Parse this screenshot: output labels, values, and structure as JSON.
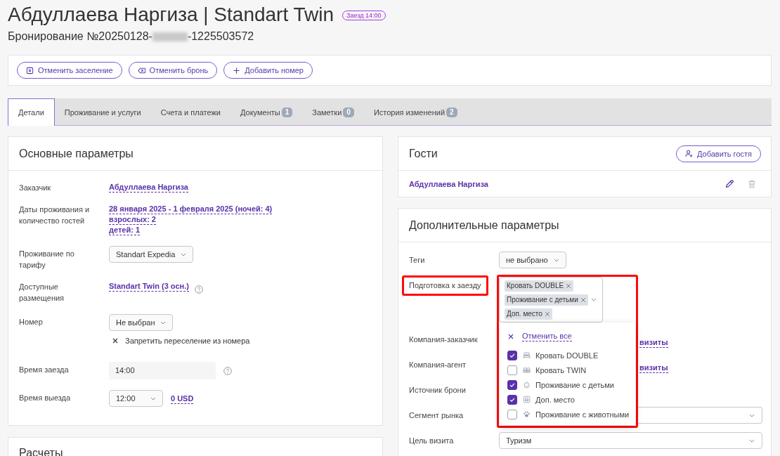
{
  "header": {
    "title": "Абдуллаева Наргиза | Standart Twin",
    "badge": "Заезд 14:00",
    "booking_prefix": "Бронирование №20250128-",
    "booking_suffix": "-1225503572"
  },
  "actions": [
    {
      "kind": "checkout",
      "label": "Отменить заселение"
    },
    {
      "kind": "cancel",
      "label": "Отменить бронь"
    },
    {
      "kind": "add",
      "label": "Добавить номер"
    }
  ],
  "tabs": [
    {
      "label": "Детали",
      "selected": true
    },
    {
      "label": "Проживание и услуги",
      "selected": false
    },
    {
      "label": "Счета и платежи",
      "selected": false
    },
    {
      "label": "Документы",
      "count": "1",
      "selected": false
    },
    {
      "label": "Заметки",
      "count": "0",
      "selected": false
    },
    {
      "label": "История изменений",
      "count": "2",
      "selected": false
    }
  ],
  "main_params": {
    "title": "Основные параметры",
    "rows": [
      {
        "kind": "link",
        "label": "Заказчик",
        "value": "Абдуллаева Наргиза"
      },
      {
        "kind": "links",
        "label": "Даты проживания и количество гостей",
        "values": [
          "28 января 2025 - 1 февраля 2025 (ночей: 4)",
          "взрослых: 2",
          "детей: 1"
        ]
      },
      {
        "kind": "select",
        "label": "Проживание по тарифу",
        "value": "Standart Expedia"
      },
      {
        "kind": "link",
        "label": "Доступные размещения",
        "value": "Standart Twin (3 осн.)",
        "help": true
      },
      {
        "kind": "select",
        "label": "Номер",
        "value": "Не выбран",
        "note": "Запретить переселение из номера"
      },
      {
        "kind": "input",
        "label": "Время заезда",
        "value": "14:00",
        "help": true
      },
      {
        "kind": "select",
        "label": "Время выезда",
        "value": "12:00",
        "link": "0 USD"
      }
    ]
  },
  "payments": {
    "title": "Расчеты"
  },
  "guests": {
    "title": "Гости",
    "add_button": "Добавить гостя",
    "items": [
      {
        "name": "Абдуллаева Наргиза"
      }
    ]
  },
  "extra_params": {
    "title": "Дополнительные параметры",
    "rows": [
      {
        "kind": "select",
        "label": "Теги",
        "value": "не выбрано"
      },
      {
        "kind": "multiselect",
        "label": "Подготовка к заезду",
        "annotated": true,
        "chips": [
          "Кровать DOUBLE",
          "Проживание с детьми",
          "Доп. место"
        ],
        "dropdown": {
          "clear": "Отменить все",
          "options": [
            {
              "kind": "double",
              "label": "Кровать DOUBLE",
              "checked": true
            },
            {
              "kind": "twin",
              "label": "Кровать TWIN",
              "checked": false
            },
            {
              "kind": "child",
              "label": "Проживание с детьми",
              "checked": true
            },
            {
              "kind": "extrabed",
              "label": "Доп. место",
              "checked": true
            },
            {
              "kind": "pet",
              "label": "Проживание с животными",
              "checked": false
            }
          ]
        }
      },
      {
        "kind": "link",
        "label": "Компания-заказчик",
        "value": "визиты"
      },
      {
        "kind": "link",
        "label": "Компания-агент",
        "value": "визиты"
      },
      {
        "kind": "blank",
        "label": "Источник брони"
      },
      {
        "kind": "select",
        "label": "Сегмент рынка",
        "wide": true
      },
      {
        "kind": "select",
        "label": "Цель визита",
        "value": "Туризм",
        "wide": true
      }
    ]
  }
}
